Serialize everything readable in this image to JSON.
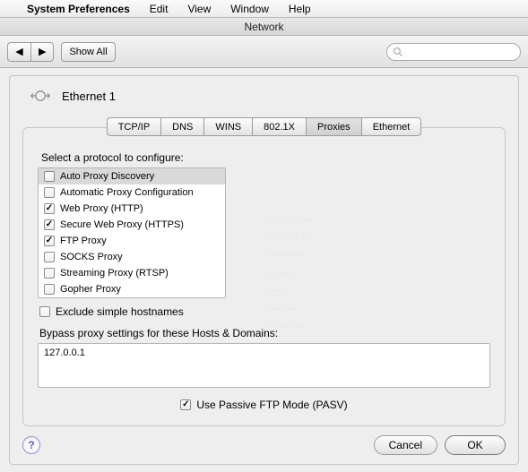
{
  "menubar": {
    "apple": "",
    "app": "System Preferences",
    "items": [
      "Edit",
      "View",
      "Window",
      "Help"
    ]
  },
  "window": {
    "title": "Network"
  },
  "toolbar": {
    "back": "◀",
    "forward": "▶",
    "show_all": "Show All",
    "search_placeholder": ""
  },
  "interface": {
    "name": "Ethernet 1"
  },
  "tabs": {
    "items": [
      "TCP/IP",
      "DNS",
      "WINS",
      "802.1X",
      "Proxies",
      "Ethernet"
    ],
    "active_index": 4
  },
  "proxies": {
    "select_label": "Select a protocol to configure:",
    "protocols": [
      {
        "label": "Auto Proxy Discovery",
        "checked": false,
        "selected": true
      },
      {
        "label": "Automatic Proxy Configuration",
        "checked": false,
        "selected": false
      },
      {
        "label": "Web Proxy (HTTP)",
        "checked": true,
        "selected": false
      },
      {
        "label": "Secure Web Proxy (HTTPS)",
        "checked": true,
        "selected": false
      },
      {
        "label": "FTP Proxy",
        "checked": true,
        "selected": false
      },
      {
        "label": "SOCKS Proxy",
        "checked": false,
        "selected": false
      },
      {
        "label": "Streaming Proxy (RTSP)",
        "checked": false,
        "selected": false
      },
      {
        "label": "Gopher Proxy",
        "checked": false,
        "selected": false
      }
    ],
    "exclude_simple": {
      "label": "Exclude simple hostnames",
      "checked": false
    },
    "bypass_label": "Bypass proxy settings for these Hosts & Domains:",
    "bypass_value": "127.0.0.1",
    "pasv": {
      "label": "Use Passive FTP Mode (PASV)",
      "checked": true
    }
  },
  "buttons": {
    "cancel": "Cancel",
    "ok": "OK"
  }
}
